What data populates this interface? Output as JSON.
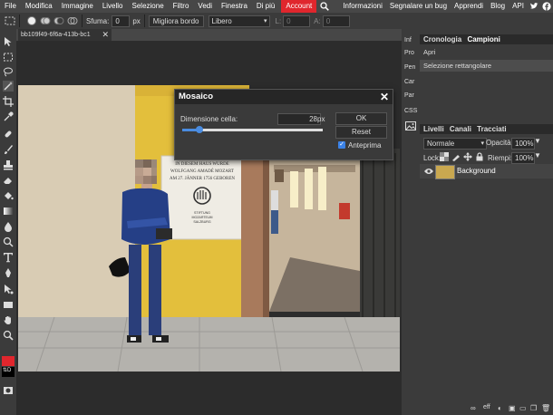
{
  "menubar": {
    "items": [
      "File",
      "Modifica",
      "Immagine",
      "Livello",
      "Selezione",
      "Filtro",
      "Vedi",
      "Finestra",
      "Di più"
    ],
    "account": "Account",
    "right_items": [
      "Informazioni",
      "Segnalare un bug",
      "Apprendi",
      "Blog",
      "API"
    ]
  },
  "options": {
    "feather_label": "Sfuma:",
    "feather_value": "0",
    "feather_unit": "px",
    "refine_button": "Migliora bordo",
    "style_value": "Libero",
    "width_label": "L:",
    "width_value": "0",
    "height_label": "A:",
    "height_value": "0"
  },
  "tab": {
    "name": "bb109f49-6f6a-413b-bc1",
    "close": "✕"
  },
  "mini_panel": [
    "Inf",
    "Pro",
    "Pen",
    "Car",
    "Par",
    "CSS"
  ],
  "history_panel": {
    "tabs": [
      "Cronologia",
      "Campioni"
    ],
    "items": [
      "Apri",
      "Selezione rettangolare"
    ]
  },
  "layers_panel": {
    "tabs": [
      "Livelli",
      "Canali",
      "Tracciati"
    ],
    "blend_mode": "Normale",
    "opacity_label": "Opacità:",
    "opacity_value": "100%",
    "lock_label": "Lock:",
    "fill_label": "Riempi:",
    "fill_value": "100%",
    "layer_name": "Background"
  },
  "dialog": {
    "title": "Mosaico",
    "close": "✕",
    "cell_label": "Dimensione cella:",
    "cell_value": "28",
    "cell_unit": "px",
    "slider_level": 0.12,
    "ok": "OK",
    "reset": "Reset",
    "preview_label": "Anteprima",
    "preview_checked": true
  },
  "photo_text": {
    "plaque": [
      "IN DIESEM HAUS WURDE",
      "WOLFGANG AMADÉ MOZART",
      "AM 27. JÄNNER 1756 GEBOREN"
    ],
    "plaque_small": [
      "STIFTUNG",
      "MOZARTEUM",
      "SALZBURG"
    ]
  },
  "colors": {
    "accent": "#e0262d",
    "panel": "#3b3b3b",
    "workspace": "#2c2c2c"
  }
}
